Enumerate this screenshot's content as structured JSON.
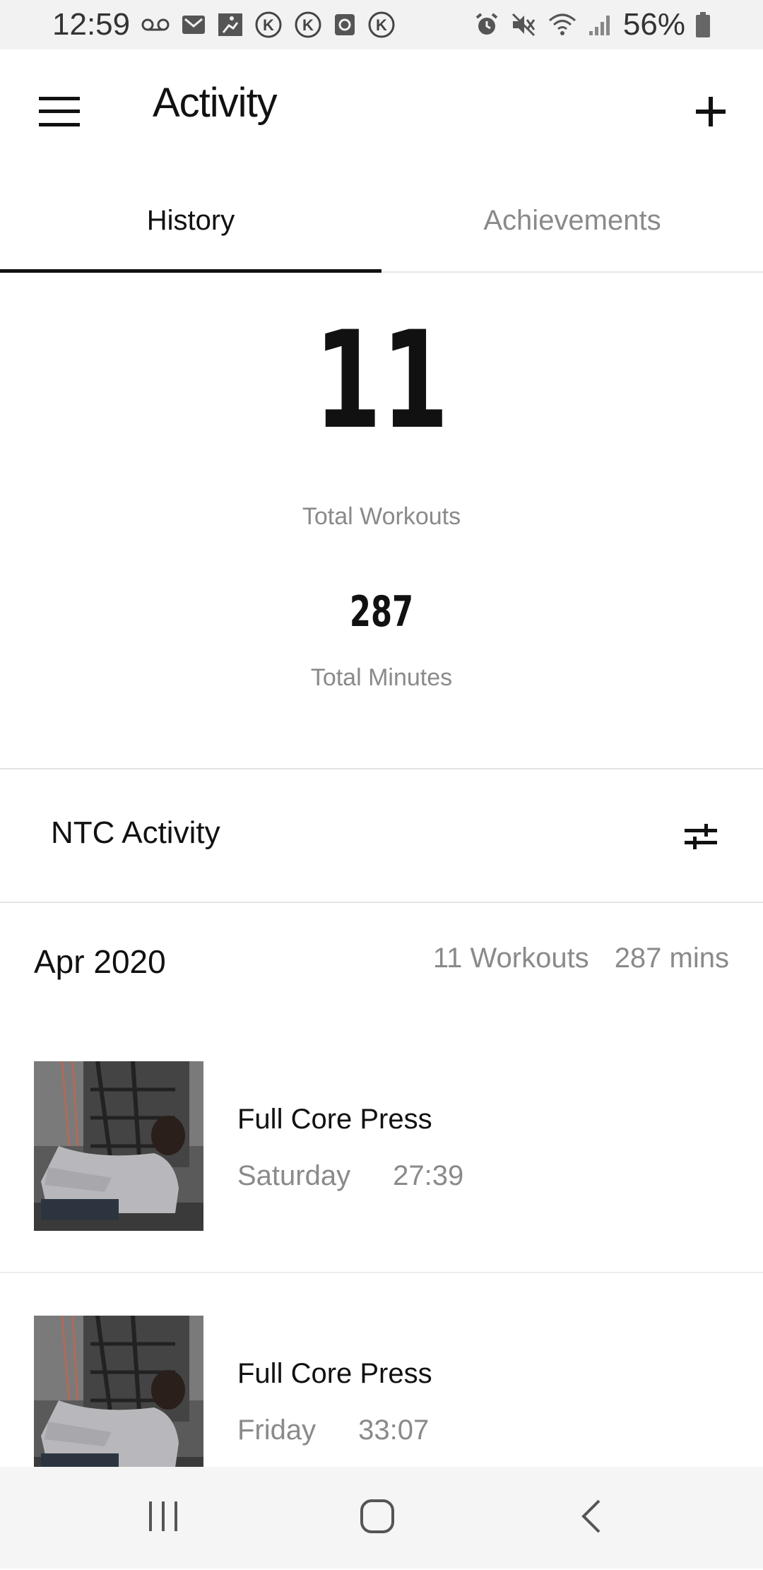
{
  "status_bar": {
    "time": "12:59",
    "battery": "56%",
    "left_icons": [
      "voicemail-icon",
      "gmail-icon",
      "fitness-app-icon",
      "k-circle-icon",
      "k-circle-icon",
      "clock-app-icon",
      "k-circle-icon"
    ],
    "right_icons": [
      "alarm-icon",
      "mute-icon",
      "wifi-icon",
      "signal-icon",
      "battery-icon"
    ]
  },
  "app_bar": {
    "title": "Activity",
    "menu_icon": "hamburger-menu-icon",
    "add_icon": "plus-icon"
  },
  "tabs": [
    {
      "label": "History",
      "active": true
    },
    {
      "label": "Achievements",
      "active": false
    }
  ],
  "stats": {
    "total_workouts": "11",
    "total_workouts_label": "Total Workouts",
    "total_minutes": "287",
    "total_minutes_label": "Total Minutes"
  },
  "section": {
    "title": "NTC Activity",
    "filter_icon": "filter-sliders-icon"
  },
  "month_summary": {
    "month": "Apr 2020",
    "workouts": "11 Workouts",
    "minutes": "287 mins"
  },
  "workouts": [
    {
      "title": "Full Core Press",
      "day": "Saturday",
      "duration": "27:39"
    },
    {
      "title": "Full Core Press",
      "day": "Friday",
      "duration": "33:07"
    }
  ],
  "nav_bar": {
    "icons": [
      "recent-apps-icon",
      "home-icon",
      "back-icon"
    ]
  },
  "colors": {
    "text_primary": "#111111",
    "text_secondary": "#8a8a8a",
    "status_bar_bg": "#f2f2f2",
    "nav_bar_bg": "#f5f5f5",
    "divider": "#e3e3e3"
  }
}
